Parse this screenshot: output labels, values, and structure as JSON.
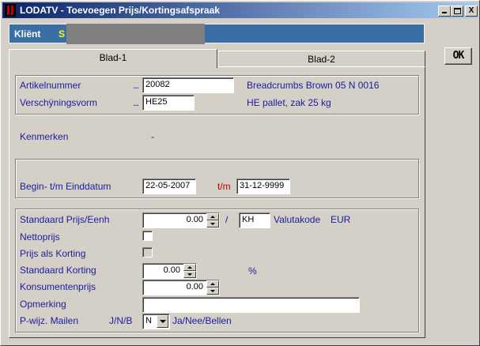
{
  "window": {
    "title": "LODATV - Toevoegen Prijs/Kortingsafspraak",
    "minimize_label": "",
    "maximize_label": "",
    "close_label": "X"
  },
  "client": {
    "label": "Kliënt",
    "value": "S"
  },
  "ok_button": {
    "label": "OK"
  },
  "tabs": [
    {
      "label": "Blad-1",
      "active": true
    },
    {
      "label": "Blad-2",
      "active": false
    }
  ],
  "article": {
    "artikelnummer_label": "Artikelnummer",
    "artikelnummer_dots": "...",
    "artikelnummer_value": "20082",
    "artikelnummer_desc": "Breadcrumbs Brown 05 N 0016",
    "verschijningsvorm_label": "Verschÿningsvorm",
    "verschijningsvorm_dots": "...",
    "verschijningsvorm_value": "HE25",
    "verschijningsvorm_desc": "HE pallet, zak 25 kg"
  },
  "kenmerken": {
    "label": "Kenmerken",
    "value": "-"
  },
  "dates": {
    "label": "Begin- t/m Einddatum",
    "begin": "22-05-2007",
    "separator": "t/m",
    "end": "31-12-9999"
  },
  "pricing": {
    "standaard_prijs_label": "Standaard Prijs/Eenh",
    "standaard_prijs_value": "0.00",
    "slash": "/",
    "unit_value": "KH",
    "valutakode_label": "Valutakode",
    "valutakode_value": "EUR",
    "nettoprijs_label": "Nettoprijs",
    "prijs_als_korting_label": "Prijs als Korting",
    "standaard_korting_label": "Standaard Korting",
    "standaard_korting_value": "0.00",
    "percent": "%",
    "konsumentenprijs_label": "Konsumentenprijs",
    "konsumentenprijs_value": "0.00",
    "opmerking_label": "Opmerking",
    "opmerking_value": "",
    "pwijz_label": "P-wijz. Mailen",
    "pwijz_hint": "J/N/B",
    "pwijz_value": "N",
    "pwijz_desc": "Ja/Nee/Bellen"
  },
  "colors": {
    "label_blue": "#1c1c9c",
    "label_red": "#c00000",
    "client_bar": "#3a6ea5",
    "client_value": "#ffff00",
    "title_start": "#0a246a",
    "title_end": "#a6caf0"
  }
}
